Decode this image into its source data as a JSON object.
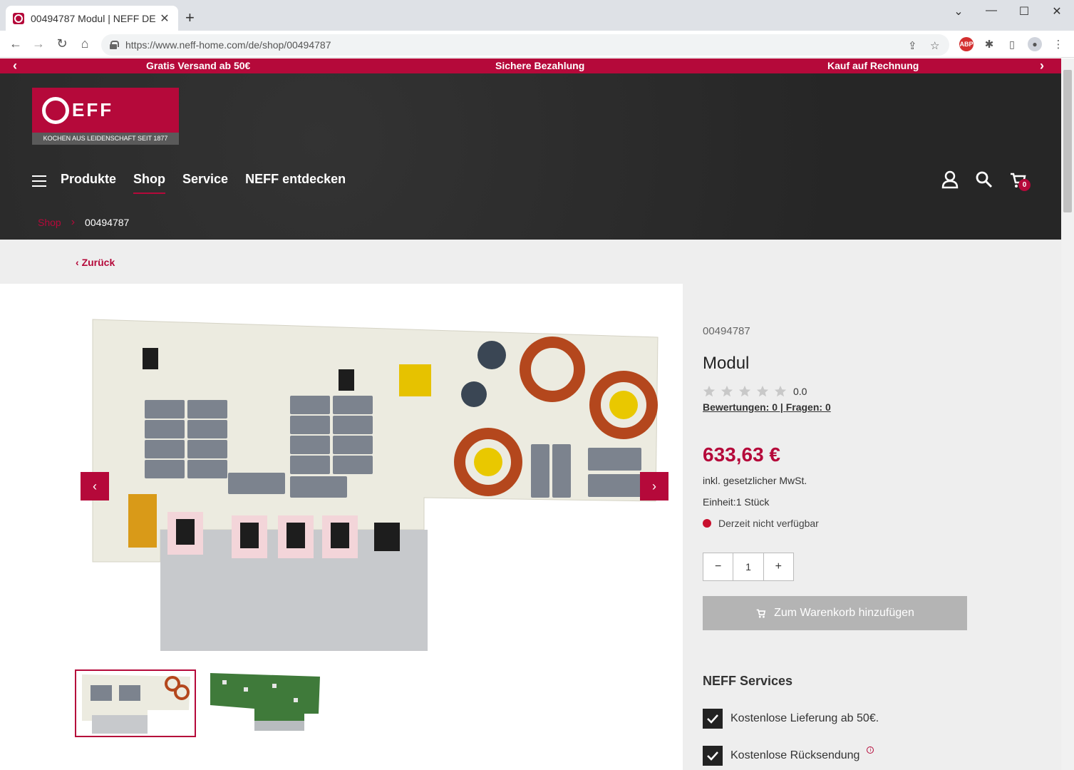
{
  "browser": {
    "tab_title": "00494787 Modul | NEFF DE",
    "tab_close": "✕",
    "new_tab": "+",
    "url": "https://www.neff-home.com/de/shop/00494787",
    "win_minimize": "⌄",
    "win_min": "—",
    "win_max": "☐",
    "win_close": "✕"
  },
  "promo": {
    "items": [
      "Gratis Versand ab 50€",
      "Sichere Bezahlung",
      "Kauf auf Rechnung"
    ]
  },
  "header": {
    "logo_text": "EFF",
    "logo_subtitle": "KOCHEN AUS LEIDENSCHAFT SEIT 1877",
    "nav": [
      "Produkte",
      "Shop",
      "Service",
      "NEFF entdecken"
    ],
    "cart_count": "0"
  },
  "breadcrumb": {
    "shop": "Shop",
    "current": "00494787"
  },
  "back_label": "Zurück",
  "product": {
    "sku": "00494787",
    "title": "Modul",
    "rating": "0.0",
    "reviews": "Bewertungen: 0",
    "reviews_sep": " | ",
    "questions": "Fragen: 0",
    "price": "633,63 €",
    "vat": "inkl. gesetzlicher MwSt.",
    "unit": "Einheit:1 Stück",
    "availability": "Derzeit nicht verfügbar",
    "qty_minus": "−",
    "qty_value": "1",
    "qty_plus": "+",
    "add_to_cart": "Zum Warenkorb hinzufügen"
  },
  "services": {
    "title": "NEFF Services",
    "items": [
      "Kostenlose Lieferung ab 50€.",
      "Kostenlose Rücksendung"
    ]
  },
  "colors": {
    "brand": "#b5093a",
    "header_bg": "#2a2a2a",
    "panel_bg": "#eeeeee",
    "button_disabled": "#b4b4b4"
  }
}
